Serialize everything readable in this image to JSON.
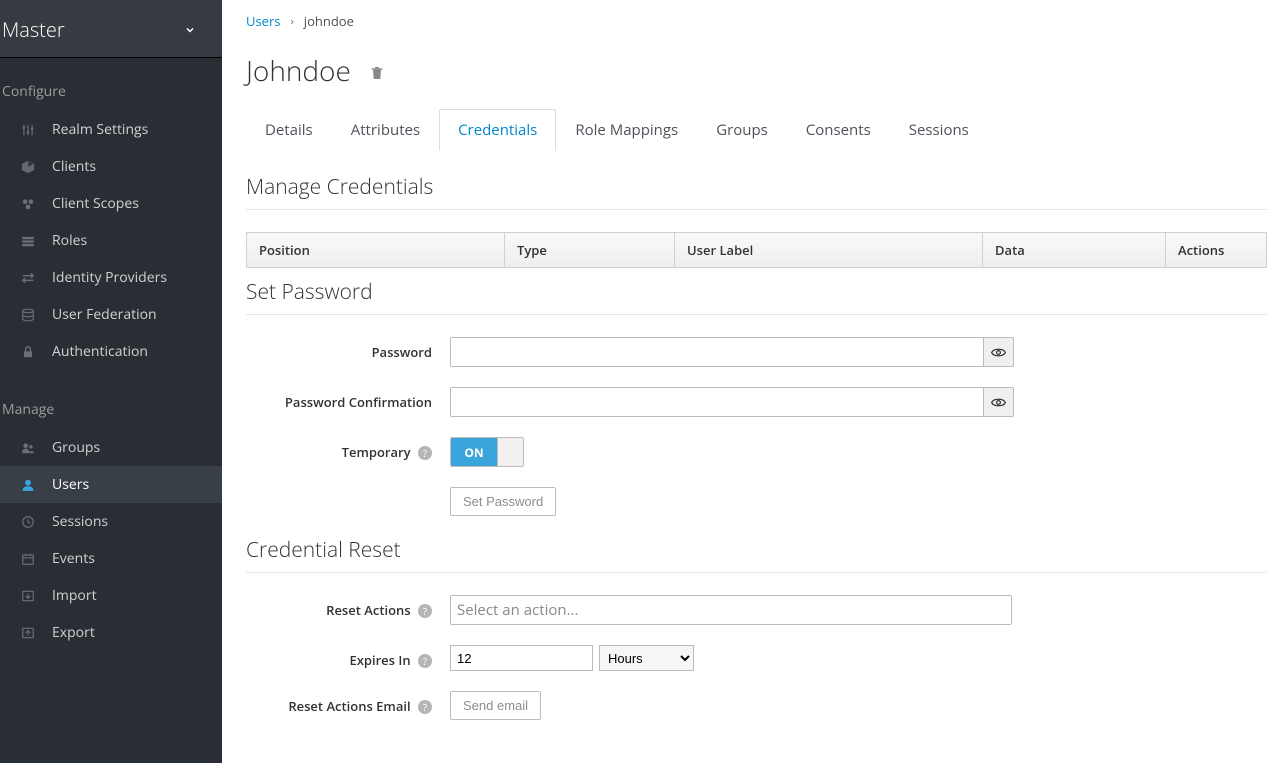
{
  "realm": {
    "name": "Master"
  },
  "sidebar": {
    "configure_label": "Configure",
    "manage_label": "Manage",
    "configure_items": [
      {
        "label": "Realm Settings"
      },
      {
        "label": "Clients"
      },
      {
        "label": "Client Scopes"
      },
      {
        "label": "Roles"
      },
      {
        "label": "Identity Providers"
      },
      {
        "label": "User Federation"
      },
      {
        "label": "Authentication"
      }
    ],
    "manage_items": [
      {
        "label": "Groups"
      },
      {
        "label": "Users"
      },
      {
        "label": "Sessions"
      },
      {
        "label": "Events"
      },
      {
        "label": "Import"
      },
      {
        "label": "Export"
      }
    ]
  },
  "breadcrumb": {
    "root": "Users",
    "current": "johndoe"
  },
  "page": {
    "title": "Johndoe"
  },
  "tabs": [
    {
      "label": "Details"
    },
    {
      "label": "Attributes"
    },
    {
      "label": "Credentials"
    },
    {
      "label": "Role Mappings"
    },
    {
      "label": "Groups"
    },
    {
      "label": "Consents"
    },
    {
      "label": "Sessions"
    }
  ],
  "sections": {
    "manage_credentials": "Manage Credentials",
    "set_password": "Set Password",
    "credential_reset": "Credential Reset"
  },
  "table_headers": {
    "position": "Position",
    "type": "Type",
    "user_label": "User Label",
    "data": "Data",
    "actions": "Actions"
  },
  "form": {
    "password_label": "Password",
    "password_confirm_label": "Password Confirmation",
    "temporary_label": "Temporary",
    "toggle_on": "ON",
    "set_password_button": "Set Password",
    "reset_actions_label": "Reset Actions",
    "reset_actions_placeholder": "Select an action...",
    "expires_in_label": "Expires In",
    "expires_in_value": "12",
    "expires_in_unit": "Hours",
    "reset_actions_email_label": "Reset Actions Email",
    "send_email_button": "Send email"
  }
}
